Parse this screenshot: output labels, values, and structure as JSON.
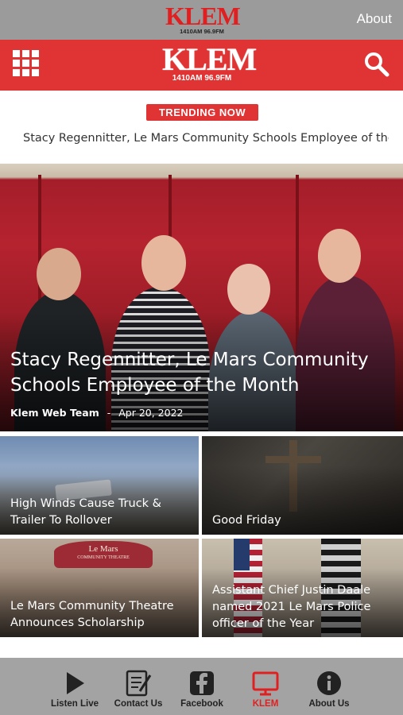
{
  "top_bar": {
    "logo_text": "KLEM",
    "logo_freq": "1410AM 96.9FM",
    "about_label": "About"
  },
  "header": {
    "logo_text": "KLEM",
    "logo_freq": "1410AM 96.9FM",
    "menu_icon": "grid-menu-icon",
    "search_icon": "search-icon",
    "brand_color": "#e03434"
  },
  "trending": {
    "badge": "TRENDING NOW",
    "headline": "Stacy Regennitter, Le Mars Community Schools Employee of the.."
  },
  "featured": {
    "title": "Stacy Regennitter, Le Mars Community Schools Employee of the Month",
    "author": "Klem Web Team",
    "separator": "-",
    "date": "Apr 20, 2022"
  },
  "tiles": [
    {
      "title": "High Winds Cause Truck & Trailer To Rollover"
    },
    {
      "title": "Good Friday"
    },
    {
      "title": "Le Mars Community Theatre Announces Scholarship"
    },
    {
      "title": "Assistant Chief Justin Daale named 2021 Le Mars Police officer of the Year"
    }
  ],
  "theatre_sign": {
    "line1": "Le Mars",
    "line2": "COMMUNITY THEATRE"
  },
  "bottom_nav": [
    {
      "label": "Listen Live",
      "icon": "play-icon"
    },
    {
      "label": "Contact Us",
      "icon": "contact-form-icon"
    },
    {
      "label": "Facebook",
      "icon": "facebook-icon"
    },
    {
      "label": "KLEM",
      "icon": "monitor-icon",
      "active": true
    },
    {
      "label": "About Us",
      "icon": "info-icon"
    }
  ],
  "colors": {
    "active_nav": "#e02020",
    "nav_bg": "#a3a3a3",
    "top_bar_bg": "#9b9b9b"
  }
}
